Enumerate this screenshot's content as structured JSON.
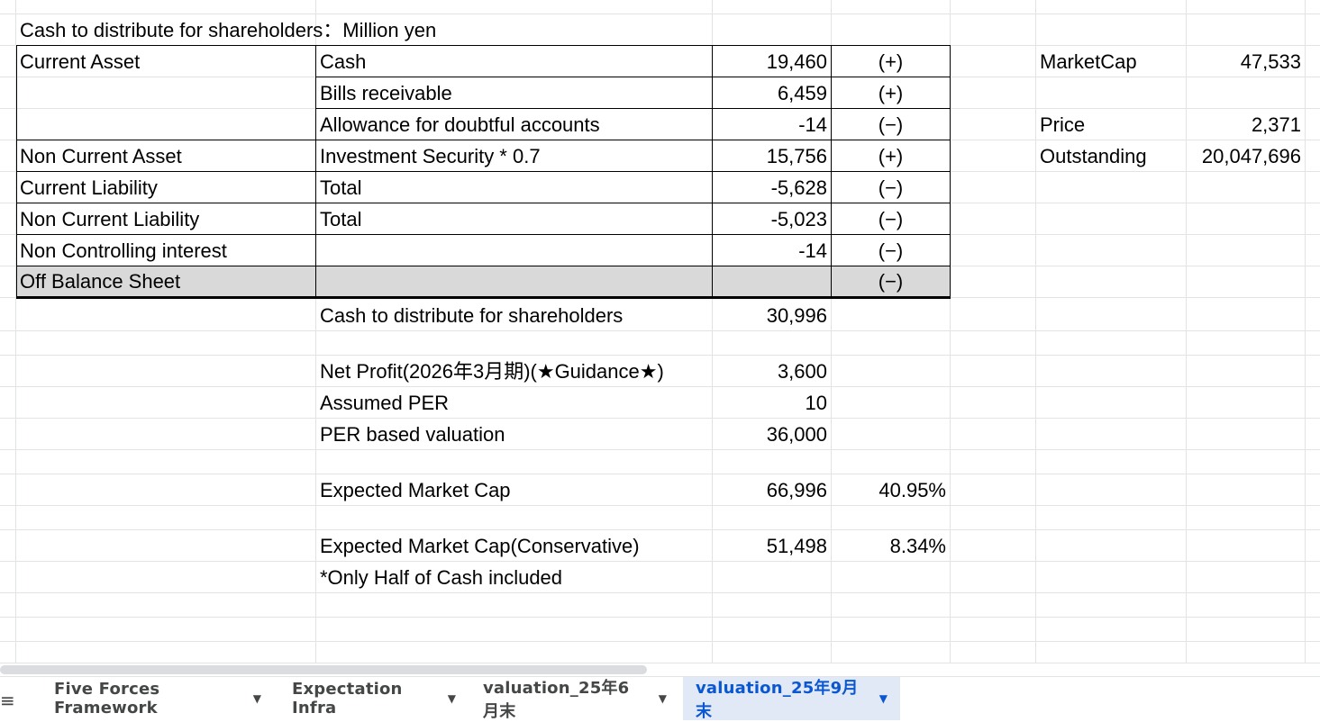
{
  "sheet": {
    "title": "Cash to distribute for shareholders：Million yen",
    "rows": [
      {
        "category": "Current Asset",
        "item": "Cash",
        "value": "19,460",
        "sign": "(+)"
      },
      {
        "category": "",
        "item": "Bills receivable",
        "value": "6,459",
        "sign": "(+)"
      },
      {
        "category": "",
        "item": "Allowance for doubtful accounts",
        "value": "-14",
        "sign": "(−)"
      },
      {
        "category": "Non Current Asset",
        "item": "Investment Security * 0.7",
        "value": "15,756",
        "sign": "(+)"
      },
      {
        "category": "Current Liability",
        "item": "Total",
        "value": "-5,628",
        "sign": "(−)"
      },
      {
        "category": "Non Current Liability",
        "item": "Total",
        "value": "-5,023",
        "sign": "(−)"
      },
      {
        "category": "Non Controlling interest",
        "item": "",
        "value": "-14",
        "sign": "(−)"
      },
      {
        "category": "Off Balance Sheet",
        "item": "",
        "value": "",
        "sign": "(−)"
      }
    ],
    "cash_distribute": {
      "label": "Cash to distribute for shareholders",
      "value": "30,996"
    },
    "net_profit": {
      "label": "Net Profit(2026年3月期)(★Guidance★)",
      "value": "3,600"
    },
    "assumed_per": {
      "label": "Assumed PER",
      "value": "10"
    },
    "per_valuation": {
      "label": "PER based valuation",
      "value": "36,000"
    },
    "expected_mc": {
      "label": "Expected Market Cap",
      "value": "66,996",
      "pct": "40.95%"
    },
    "expected_mc_cons": {
      "label": "Expected Market Cap(Conservative)",
      "value": "51,498",
      "pct": "8.34%"
    },
    "note": "*Only Half of Cash included",
    "side": {
      "marketcap_label": "MarketCap",
      "marketcap_value": "47,533",
      "price_label": "Price",
      "price_value": "2,371",
      "outstanding_label": "Outstanding",
      "outstanding_value": "20,047,696"
    }
  },
  "tabs": [
    {
      "label": "Five Forces Framework",
      "active": false
    },
    {
      "label": "Expectation Infra",
      "active": false
    },
    {
      "label": "valuation_25年6月末",
      "active": false
    },
    {
      "label": "valuation_25年9月末",
      "active": true
    }
  ],
  "colors": {
    "grid": "#e2e3e3",
    "gray_row": "#d9d9d9",
    "active_tab_bg": "#e1e9f7",
    "active_tab_text": "#0b57d0"
  },
  "icons": {
    "sheets_menu": "hamburger-icon",
    "tab_dropdown": "caret-down-icon"
  }
}
